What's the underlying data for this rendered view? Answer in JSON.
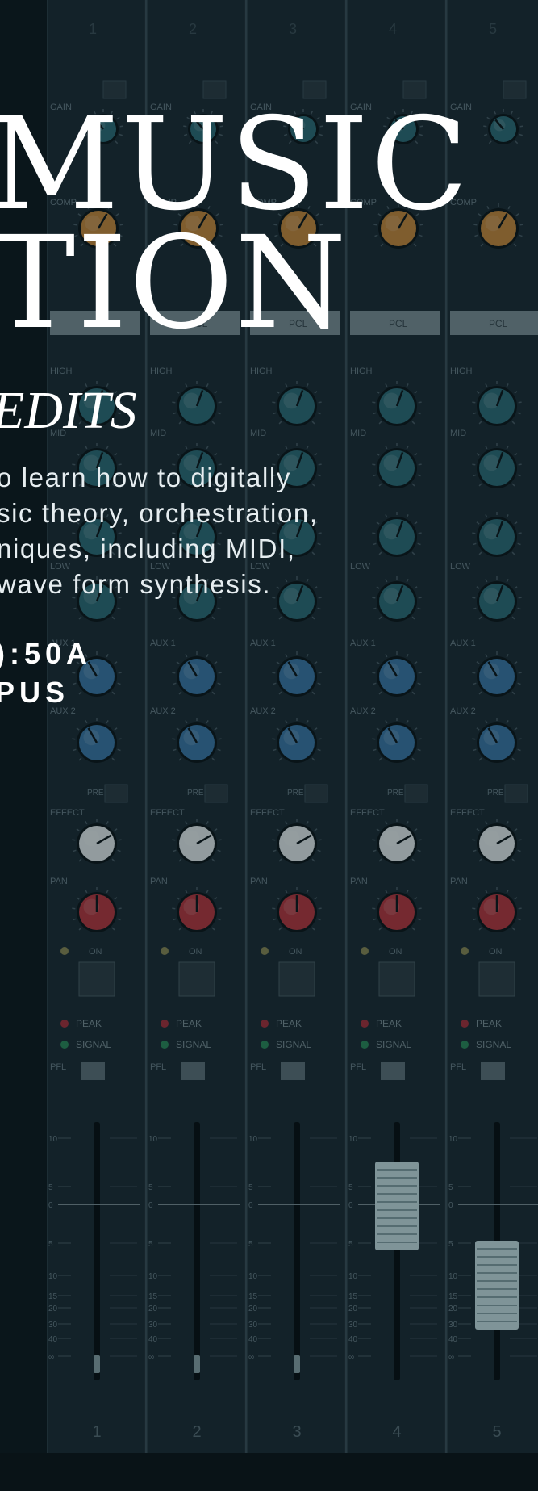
{
  "flyer": {
    "title_line_1": "MUSIC",
    "title_line_2": "TION",
    "subtitle": "EDITS",
    "description_lines": [
      "o learn how to digitally",
      "sic theory, orchestration,",
      "niques, including MIDI,",
      "wave form synthesis."
    ],
    "schedule_time": "):50A",
    "schedule_place": "PUS"
  },
  "mixer": {
    "channel_numbers": [
      "1",
      "2",
      "3",
      "4",
      "5"
    ],
    "strip_labels": {
      "gain": "GAIN",
      "comp": "COMP",
      "pcl": "PCL",
      "high": "HIGH",
      "mid": "MID",
      "low": "LOW",
      "aux1": "AUX 1",
      "aux2": "AUX 2",
      "effect": "EFFECT",
      "pan": "PAN",
      "on": "ON",
      "peak": "PEAK",
      "signal": "SIGNAL",
      "pfl": "PFL",
      "pre": "PRE"
    },
    "fader_scale": [
      "10",
      "5",
      "0",
      "5",
      "10",
      "15",
      "20",
      "30",
      "40",
      "∞"
    ],
    "fader_levels": [
      0.0,
      0.0,
      0.0,
      0.7,
      0.35
    ]
  },
  "colors": {
    "background": "#0e1a20",
    "panel": "#1b2b33",
    "knob_teal": "#2d6d78",
    "knob_blue": "#3a78a8",
    "knob_orange": "#c9893a",
    "knob_white": "#e7eeef",
    "knob_red": "#b8363e",
    "fader_cap": "#c9e2e6",
    "text": "#ffffff"
  }
}
